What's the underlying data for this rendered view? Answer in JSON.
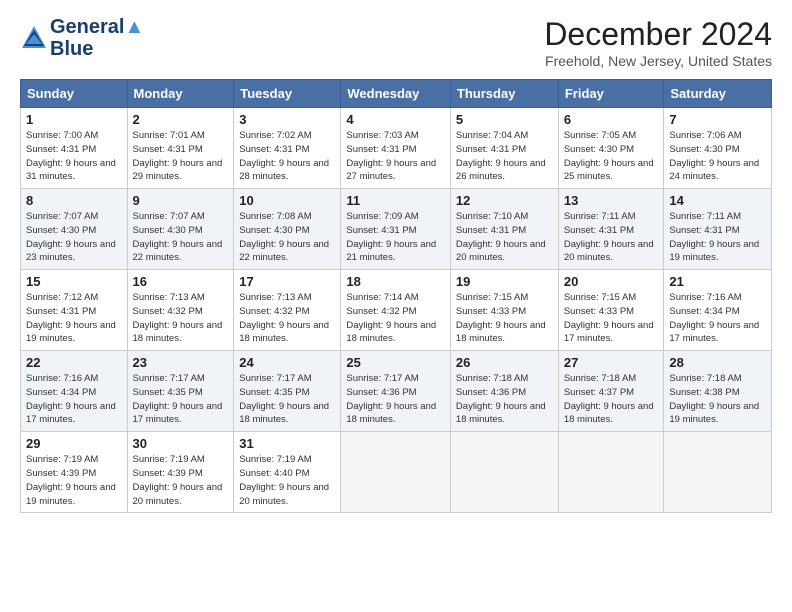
{
  "logo": {
    "line1": "General",
    "line2": "Blue"
  },
  "title": "December 2024",
  "location": "Freehold, New Jersey, United States",
  "days_of_week": [
    "Sunday",
    "Monday",
    "Tuesday",
    "Wednesday",
    "Thursday",
    "Friday",
    "Saturday"
  ],
  "weeks": [
    [
      {
        "day": 1,
        "sunrise": "7:00 AM",
        "sunset": "4:31 PM",
        "daylight": "9 hours and 31 minutes."
      },
      {
        "day": 2,
        "sunrise": "7:01 AM",
        "sunset": "4:31 PM",
        "daylight": "9 hours and 29 minutes."
      },
      {
        "day": 3,
        "sunrise": "7:02 AM",
        "sunset": "4:31 PM",
        "daylight": "9 hours and 28 minutes."
      },
      {
        "day": 4,
        "sunrise": "7:03 AM",
        "sunset": "4:31 PM",
        "daylight": "9 hours and 27 minutes."
      },
      {
        "day": 5,
        "sunrise": "7:04 AM",
        "sunset": "4:31 PM",
        "daylight": "9 hours and 26 minutes."
      },
      {
        "day": 6,
        "sunrise": "7:05 AM",
        "sunset": "4:30 PM",
        "daylight": "9 hours and 25 minutes."
      },
      {
        "day": 7,
        "sunrise": "7:06 AM",
        "sunset": "4:30 PM",
        "daylight": "9 hours and 24 minutes."
      }
    ],
    [
      {
        "day": 8,
        "sunrise": "7:07 AM",
        "sunset": "4:30 PM",
        "daylight": "9 hours and 23 minutes."
      },
      {
        "day": 9,
        "sunrise": "7:07 AM",
        "sunset": "4:30 PM",
        "daylight": "9 hours and 22 minutes."
      },
      {
        "day": 10,
        "sunrise": "7:08 AM",
        "sunset": "4:30 PM",
        "daylight": "9 hours and 22 minutes."
      },
      {
        "day": 11,
        "sunrise": "7:09 AM",
        "sunset": "4:31 PM",
        "daylight": "9 hours and 21 minutes."
      },
      {
        "day": 12,
        "sunrise": "7:10 AM",
        "sunset": "4:31 PM",
        "daylight": "9 hours and 20 minutes."
      },
      {
        "day": 13,
        "sunrise": "7:11 AM",
        "sunset": "4:31 PM",
        "daylight": "9 hours and 20 minutes."
      },
      {
        "day": 14,
        "sunrise": "7:11 AM",
        "sunset": "4:31 PM",
        "daylight": "9 hours and 19 minutes."
      }
    ],
    [
      {
        "day": 15,
        "sunrise": "7:12 AM",
        "sunset": "4:31 PM",
        "daylight": "9 hours and 19 minutes."
      },
      {
        "day": 16,
        "sunrise": "7:13 AM",
        "sunset": "4:32 PM",
        "daylight": "9 hours and 18 minutes."
      },
      {
        "day": 17,
        "sunrise": "7:13 AM",
        "sunset": "4:32 PM",
        "daylight": "9 hours and 18 minutes."
      },
      {
        "day": 18,
        "sunrise": "7:14 AM",
        "sunset": "4:32 PM",
        "daylight": "9 hours and 18 minutes."
      },
      {
        "day": 19,
        "sunrise": "7:15 AM",
        "sunset": "4:33 PM",
        "daylight": "9 hours and 18 minutes."
      },
      {
        "day": 20,
        "sunrise": "7:15 AM",
        "sunset": "4:33 PM",
        "daylight": "9 hours and 17 minutes."
      },
      {
        "day": 21,
        "sunrise": "7:16 AM",
        "sunset": "4:34 PM",
        "daylight": "9 hours and 17 minutes."
      }
    ],
    [
      {
        "day": 22,
        "sunrise": "7:16 AM",
        "sunset": "4:34 PM",
        "daylight": "9 hours and 17 minutes."
      },
      {
        "day": 23,
        "sunrise": "7:17 AM",
        "sunset": "4:35 PM",
        "daylight": "9 hours and 17 minutes."
      },
      {
        "day": 24,
        "sunrise": "7:17 AM",
        "sunset": "4:35 PM",
        "daylight": "9 hours and 18 minutes."
      },
      {
        "day": 25,
        "sunrise": "7:17 AM",
        "sunset": "4:36 PM",
        "daylight": "9 hours and 18 minutes."
      },
      {
        "day": 26,
        "sunrise": "7:18 AM",
        "sunset": "4:36 PM",
        "daylight": "9 hours and 18 minutes."
      },
      {
        "day": 27,
        "sunrise": "7:18 AM",
        "sunset": "4:37 PM",
        "daylight": "9 hours and 18 minutes."
      },
      {
        "day": 28,
        "sunrise": "7:18 AM",
        "sunset": "4:38 PM",
        "daylight": "9 hours and 19 minutes."
      }
    ],
    [
      {
        "day": 29,
        "sunrise": "7:19 AM",
        "sunset": "4:39 PM",
        "daylight": "9 hours and 19 minutes."
      },
      {
        "day": 30,
        "sunrise": "7:19 AM",
        "sunset": "4:39 PM",
        "daylight": "9 hours and 20 minutes."
      },
      {
        "day": 31,
        "sunrise": "7:19 AM",
        "sunset": "4:40 PM",
        "daylight": "9 hours and 20 minutes."
      },
      null,
      null,
      null,
      null
    ]
  ]
}
